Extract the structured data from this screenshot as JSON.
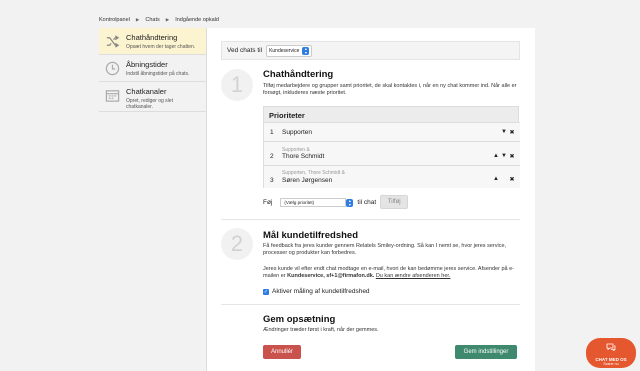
{
  "breadcrumb": {
    "items": [
      "Kontrolpanel",
      "Chats",
      "Indgående opkald"
    ],
    "sep": "▶"
  },
  "sidebar": {
    "items": [
      {
        "title": "Chathåndtering",
        "desc": "Opsæt hvem der tager chatten.",
        "icon": "shuffle-icon"
      },
      {
        "title": "Åbningstider",
        "desc": "Indstil åbningstider på chats.",
        "icon": "clock-icon"
      },
      {
        "title": "Chatkanaler",
        "desc": "Opret, rediger og slet chatkanaler.",
        "icon": "calendar-icon"
      }
    ]
  },
  "topbar": {
    "label": "Ved chats til",
    "select_value": "Kundeservice"
  },
  "sections": [
    {
      "number": "1",
      "title": "Chathåndtering",
      "text": "Tilføj medarbejdere og grupper samt prioritet, de skal kontaktes i, når en ny chat kommer ind. Når alle er forsøgt, inkluderes næste prioritet."
    },
    {
      "number": "2",
      "title": "Mål kundetilfredshed",
      "text1": "Få feedback fra jeres kunder gennem Relatels Smiley-ordning. Så kan I nemt se, hvor jeres service, processer og produkter kan forbedres.",
      "text2_a": "Jeres kunde vil efter endt chat modtage en e-mail, hvori de kan bedømme jeres service. Afsender på e-mailen er ",
      "text2_bold": "Kundeservice, sf+1@firmafon.dk.",
      "text2_link": "Du kan ændre afsenderen her.",
      "checkbox_label": "Aktiver måling af kundetilfredshed"
    },
    {
      "title": "Gem opsætning",
      "text": "Ændringer træder først i kraft, når der gemmes."
    }
  ],
  "priorities": {
    "header": "Prioriteter",
    "rows": [
      {
        "num": "1",
        "prev": "",
        "name": "Supporten",
        "controls": [
          "▼",
          "✖"
        ]
      },
      {
        "num": "2",
        "prev": "Supporten &",
        "name": "Thore Schmidt",
        "controls": [
          "▲",
          "▼",
          "✖"
        ]
      },
      {
        "num": "3",
        "prev": "Supporten, Thore Schmidt &",
        "name": "Søren Jørgensen",
        "controls": [
          "▲",
          "",
          "✖"
        ]
      }
    ]
  },
  "add_line": {
    "prefix": "Føj",
    "select_placeholder": "(Vælg prioritet)",
    "suffix": "til chat",
    "button": "Tilføj"
  },
  "buttons": {
    "cancel": "Annullér",
    "save": "Gem indstillinger"
  },
  "chat_widget": {
    "line1": "CHAT MED OS",
    "line2": "Svarer nu"
  },
  "colors": {
    "accent": "#2f7de1",
    "active_bg": "#fcf3d0",
    "cancel": "#c9524d",
    "save": "#3f8a6e",
    "chat": "#e5572e"
  }
}
